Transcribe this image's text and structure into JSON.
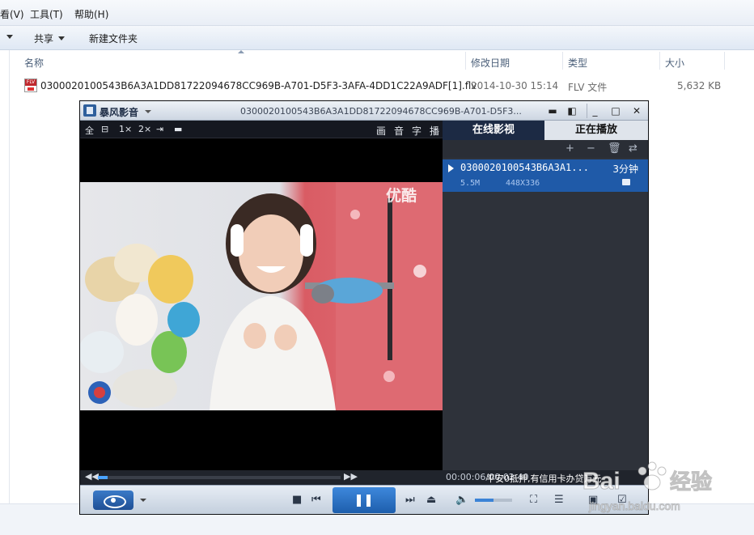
{
  "explorer": {
    "menu": {
      "view": "看(V)",
      "tools": "工具(T)",
      "help": "帮助(H)"
    },
    "toolbar": {
      "share": "共享",
      "new_folder": "新建文件夹"
    },
    "columns": {
      "name": "名称",
      "date": "修改日期",
      "type": "类型",
      "size": "大小"
    },
    "file": {
      "name": "0300020100543B6A3A1DD81722094678CC969B-A701-D5F3-3AFA-4DD1C22A9ADF[1].flv",
      "date": "2014-10-30 15:14",
      "type": "FLV 文件",
      "size": "5,632 KB",
      "icon": "flv-file-icon"
    }
  },
  "player": {
    "app_name": "暴风影音",
    "title": "0300020100543B6A3A1DD81722094678CC969B-A701-D5F3...",
    "video_toolbar_left": [
      "全",
      "⊟",
      "1×",
      "2×",
      "⇥",
      "▬"
    ],
    "video_toolbar_right": [
      "画",
      "音",
      "字",
      "播"
    ],
    "watermark": "优酷",
    "tabs": {
      "online": "在线影视",
      "now_playing": "正在播放"
    },
    "playlist_tools": [
      "+",
      "−",
      "🗑",
      "⇄"
    ],
    "playlist": [
      {
        "name": "0300020100543B6A3A1...",
        "duration": "3分钟",
        "size": "5.5M",
        "resolution": "448X336"
      }
    ],
    "time": "00:00:06/00:02:40",
    "ad_text": "平安0抵押,有信用卡办贷万元",
    "progress_fraction": 0.04,
    "volume_fraction": 0.5,
    "accent": "#2a6fc9"
  },
  "watermark_site": {
    "brand": "Baidu 经验",
    "url": "jingyan.baidu.com"
  }
}
